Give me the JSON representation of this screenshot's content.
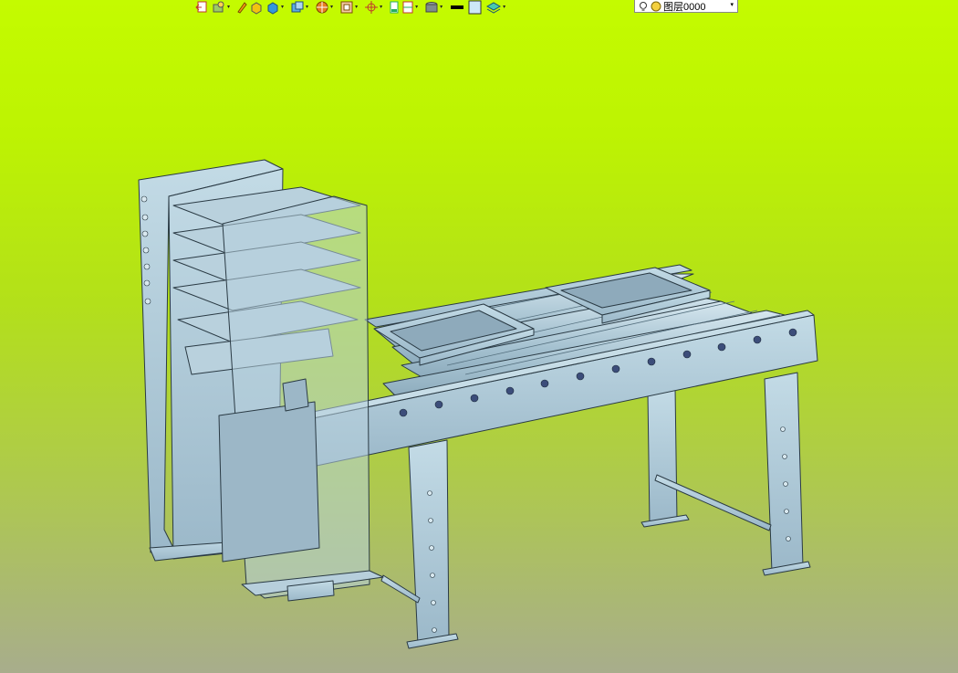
{
  "toolbar": {
    "layer_name": "图层0000",
    "dropdown_glyph": "▾",
    "tools": [
      {
        "name": "exit-sketch-icon"
      },
      {
        "name": "render-mode-icon"
      },
      {
        "name": "pencil-icon"
      },
      {
        "name": "box-yellow-icon"
      },
      {
        "name": "box-blue-icon"
      },
      {
        "name": "view-orient-icon"
      },
      {
        "name": "section-view-icon"
      },
      {
        "name": "display-style-icon"
      },
      {
        "name": "origin-axis-icon"
      },
      {
        "name": "sheet-icon"
      },
      {
        "name": "sheet-format-icon"
      },
      {
        "name": "light-icon"
      },
      {
        "name": "line-color-icon"
      },
      {
        "name": "fill-color-icon"
      },
      {
        "name": "layer-stack-icon"
      }
    ]
  },
  "colors": {
    "background_top": "#c4fb00",
    "background_bottom": "#a8ad8c",
    "steel": "#a9c6d6",
    "steel_dark": "#7f9fb2",
    "edge": "#2a3a44"
  }
}
